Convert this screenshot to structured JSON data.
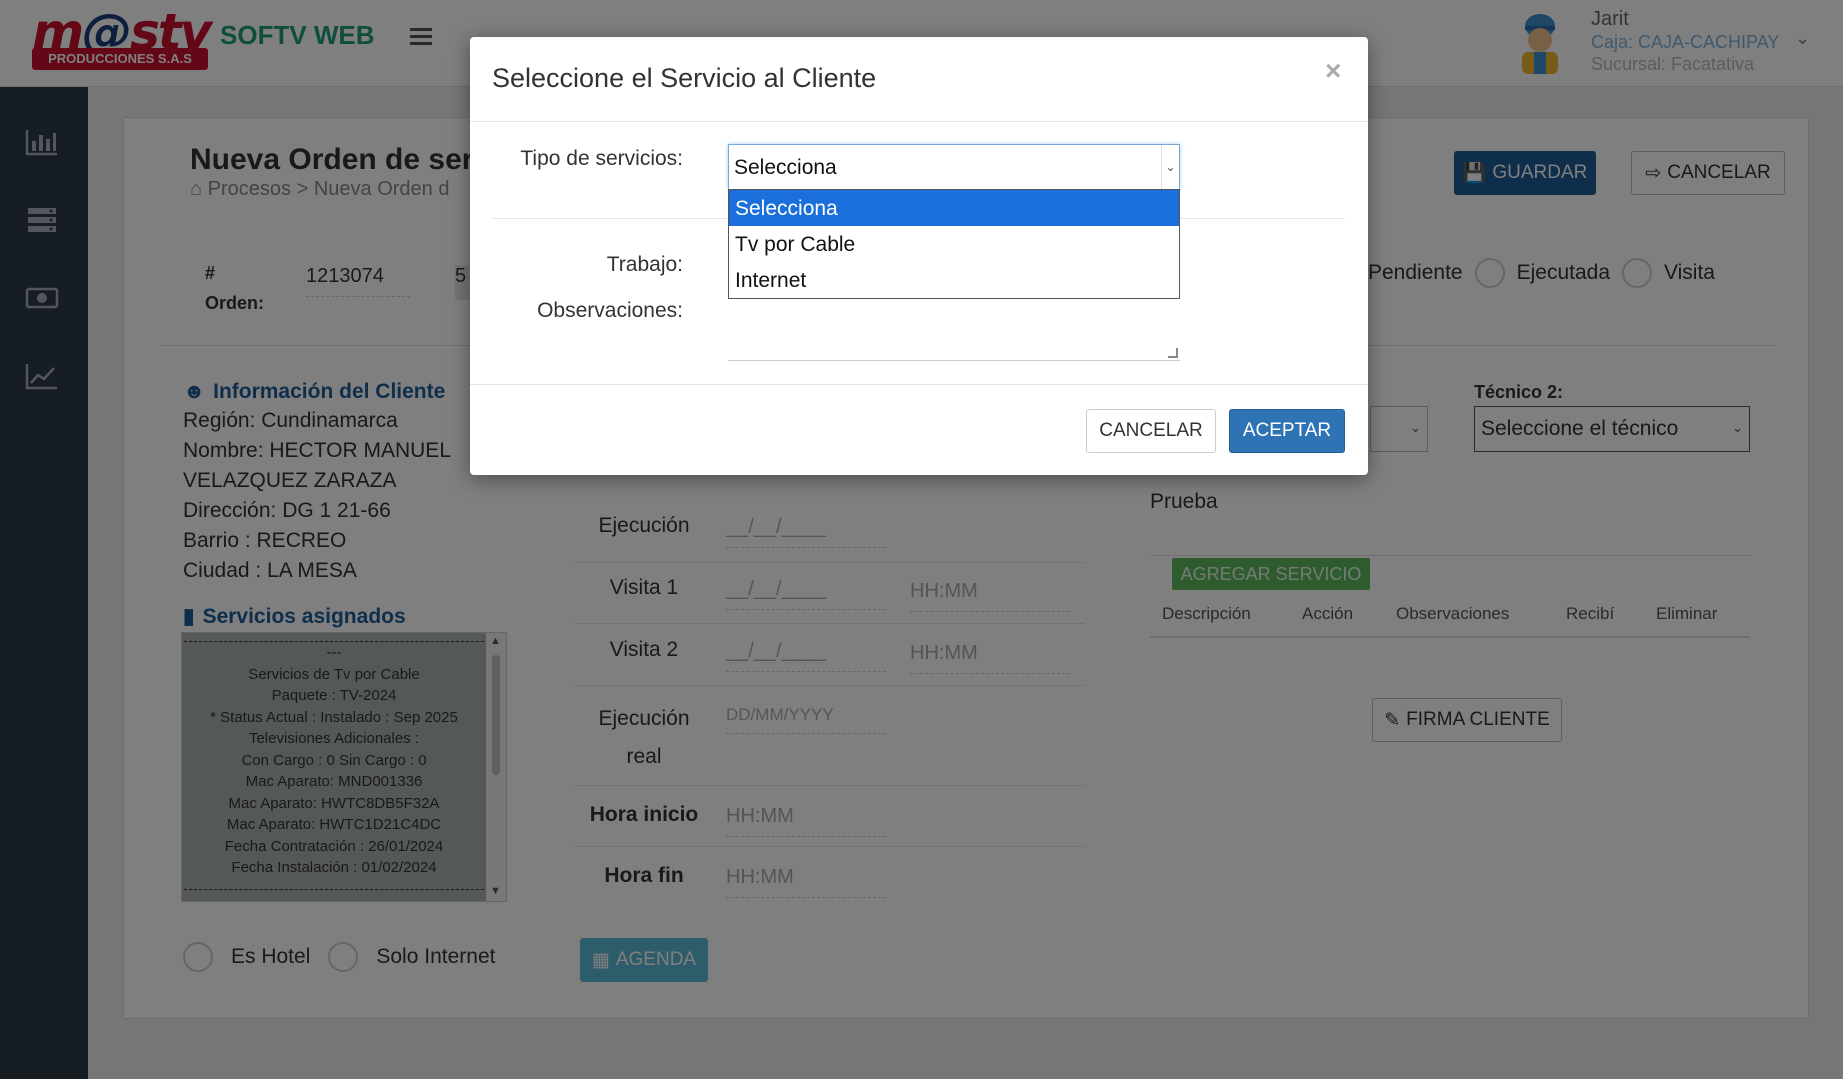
{
  "header": {
    "logo_brand": "m@stv",
    "logo_sub": "PRODUCCIONES S.A.S",
    "app_name": "SOFTV WEB",
    "user_name": "Jarit",
    "user_caja": "Caja: CAJA-CACHIPAY",
    "user_sucursal": "Sucursal: Facatativa"
  },
  "sidebar": {
    "icons": [
      "bar-chart-icon",
      "server-icon",
      "money-icon",
      "line-chart-icon"
    ]
  },
  "page": {
    "title": "Nueva Orden de ser",
    "breadcrumb": "Procesos > Nueva Orden d",
    "guardar": "GUARDAR",
    "cancelar": "CANCELAR",
    "orden_label_1": "#",
    "orden_label_2": "Orden:",
    "orden_value": "1213074",
    "orden_value_2": "5",
    "status": [
      "Pendiente",
      "Ejecutada",
      "Visita"
    ]
  },
  "cliente": {
    "title": "Información del Cliente",
    "region": "Región: Cundinamarca",
    "nombre_1": "Nombre: HECTOR MANUEL",
    "nombre_2": "VELAZQUEZ ZARAZA",
    "direccion": "Dirección: DG 1 21-66",
    "barrio": "Barrio : RECREO",
    "ciudad": "Ciudad : LA MESA"
  },
  "servicios": {
    "title": "Servicios asignados",
    "lines": [
      "---",
      "Servicios de Tv por Cable",
      "Paquete : TV-2024",
      "* Status Actual : Instalado : Sep 2025",
      "Televisiones Adicionales :",
      "Con Cargo : 0 Sin Cargo : 0",
      "Mac Aparato: MND001336",
      "Mac Aparato: HWTC8DB5F32A",
      "Mac Aparato: HWTC1D21C4DC",
      "Fecha Contratación : 26/01/2024",
      "Fecha Instalación : 01/02/2024"
    ]
  },
  "checks": {
    "hotel": "Es Hotel",
    "internet": "Solo Internet"
  },
  "fechas": {
    "ejecucion": "Ejecución",
    "ejecucion_val": "__/__/____",
    "visita1": "Visita 1",
    "visita1_val": "__/__/____",
    "visita1_hora": "HH:MM",
    "visita2": "Visita 2",
    "visita2_val": "__/__/____",
    "visita2_hora": "HH:MM",
    "ejec_real_1": "Ejecución",
    "ejec_real_2": "real",
    "ejec_real_val": "DD/MM/YYYY",
    "hora_inicio": "Hora inicio",
    "hora_inicio_val": "HH:MM",
    "hora_fin": "Hora fin",
    "hora_fin_val": "HH:MM",
    "agenda": "AGENDA"
  },
  "right": {
    "tecnico2_label": "Técnico 2:",
    "tecnico2_value": "Seleccione el técnico",
    "observaciones_value": "Prueba",
    "agregar": "AGREGAR SERVICIO",
    "cols": [
      "Descripción",
      "Acción",
      "Observaciones",
      "Recibí",
      "Eliminar"
    ],
    "firma": "FIRMA CLIENTE"
  },
  "modal": {
    "title": "Seleccione el Servicio al Cliente",
    "close": "×",
    "tipo_label": "Tipo de servicios:",
    "tipo_value": "Selecciona",
    "options": [
      "Selecciona",
      "Tv por Cable",
      "Internet"
    ],
    "trabajo_label": "Trabajo:",
    "observaciones_label": "Observaciones:",
    "cancelar": "CANCELAR",
    "aceptar": "ACEPTAR"
  },
  "colors": {
    "primary": "#1e5c96",
    "brand_red": "#c8102e",
    "app_green": "#1f9a7a",
    "sidebar": "#2c3a47",
    "success": "#5cb85c",
    "info": "#5bb8d6",
    "dropdown_highlight": "#1a6fdb"
  }
}
